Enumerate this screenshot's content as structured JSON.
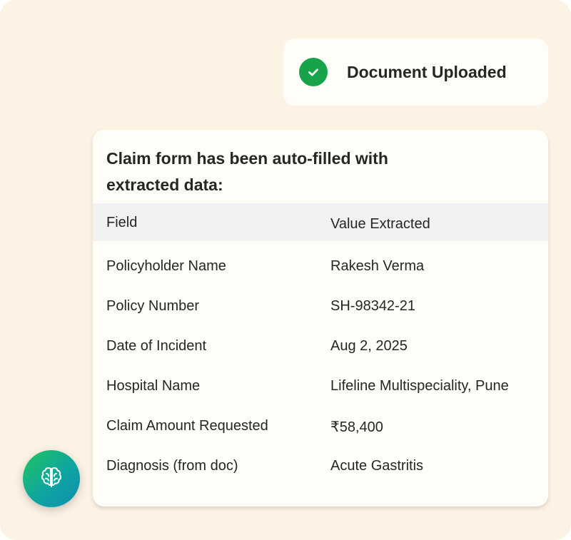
{
  "upload_status": {
    "label": "Document Uploaded",
    "icon": "check-icon",
    "color": "#16a34a"
  },
  "claim_card": {
    "title": "Claim form has been auto-filled with extracted data:",
    "headers": {
      "field": "Field",
      "value": "Value Extracted"
    },
    "rows": [
      {
        "field": "Policyholder Name",
        "value": "Rakesh Verma"
      },
      {
        "field": "Policy Number",
        "value": "SH-98342-21"
      },
      {
        "field": "Date of Incident",
        "value": "Aug 2, 2025"
      },
      {
        "field": "Hospital Name",
        "value": "Lifeline Multispeciality, Pune"
      },
      {
        "field": "Claim Amount Requested",
        "value": "₹58,400"
      },
      {
        "field": "Diagnosis (from doc)",
        "value": "Acute Gastritis"
      }
    ]
  },
  "assistant_button": {
    "icon": "brain-icon"
  }
}
